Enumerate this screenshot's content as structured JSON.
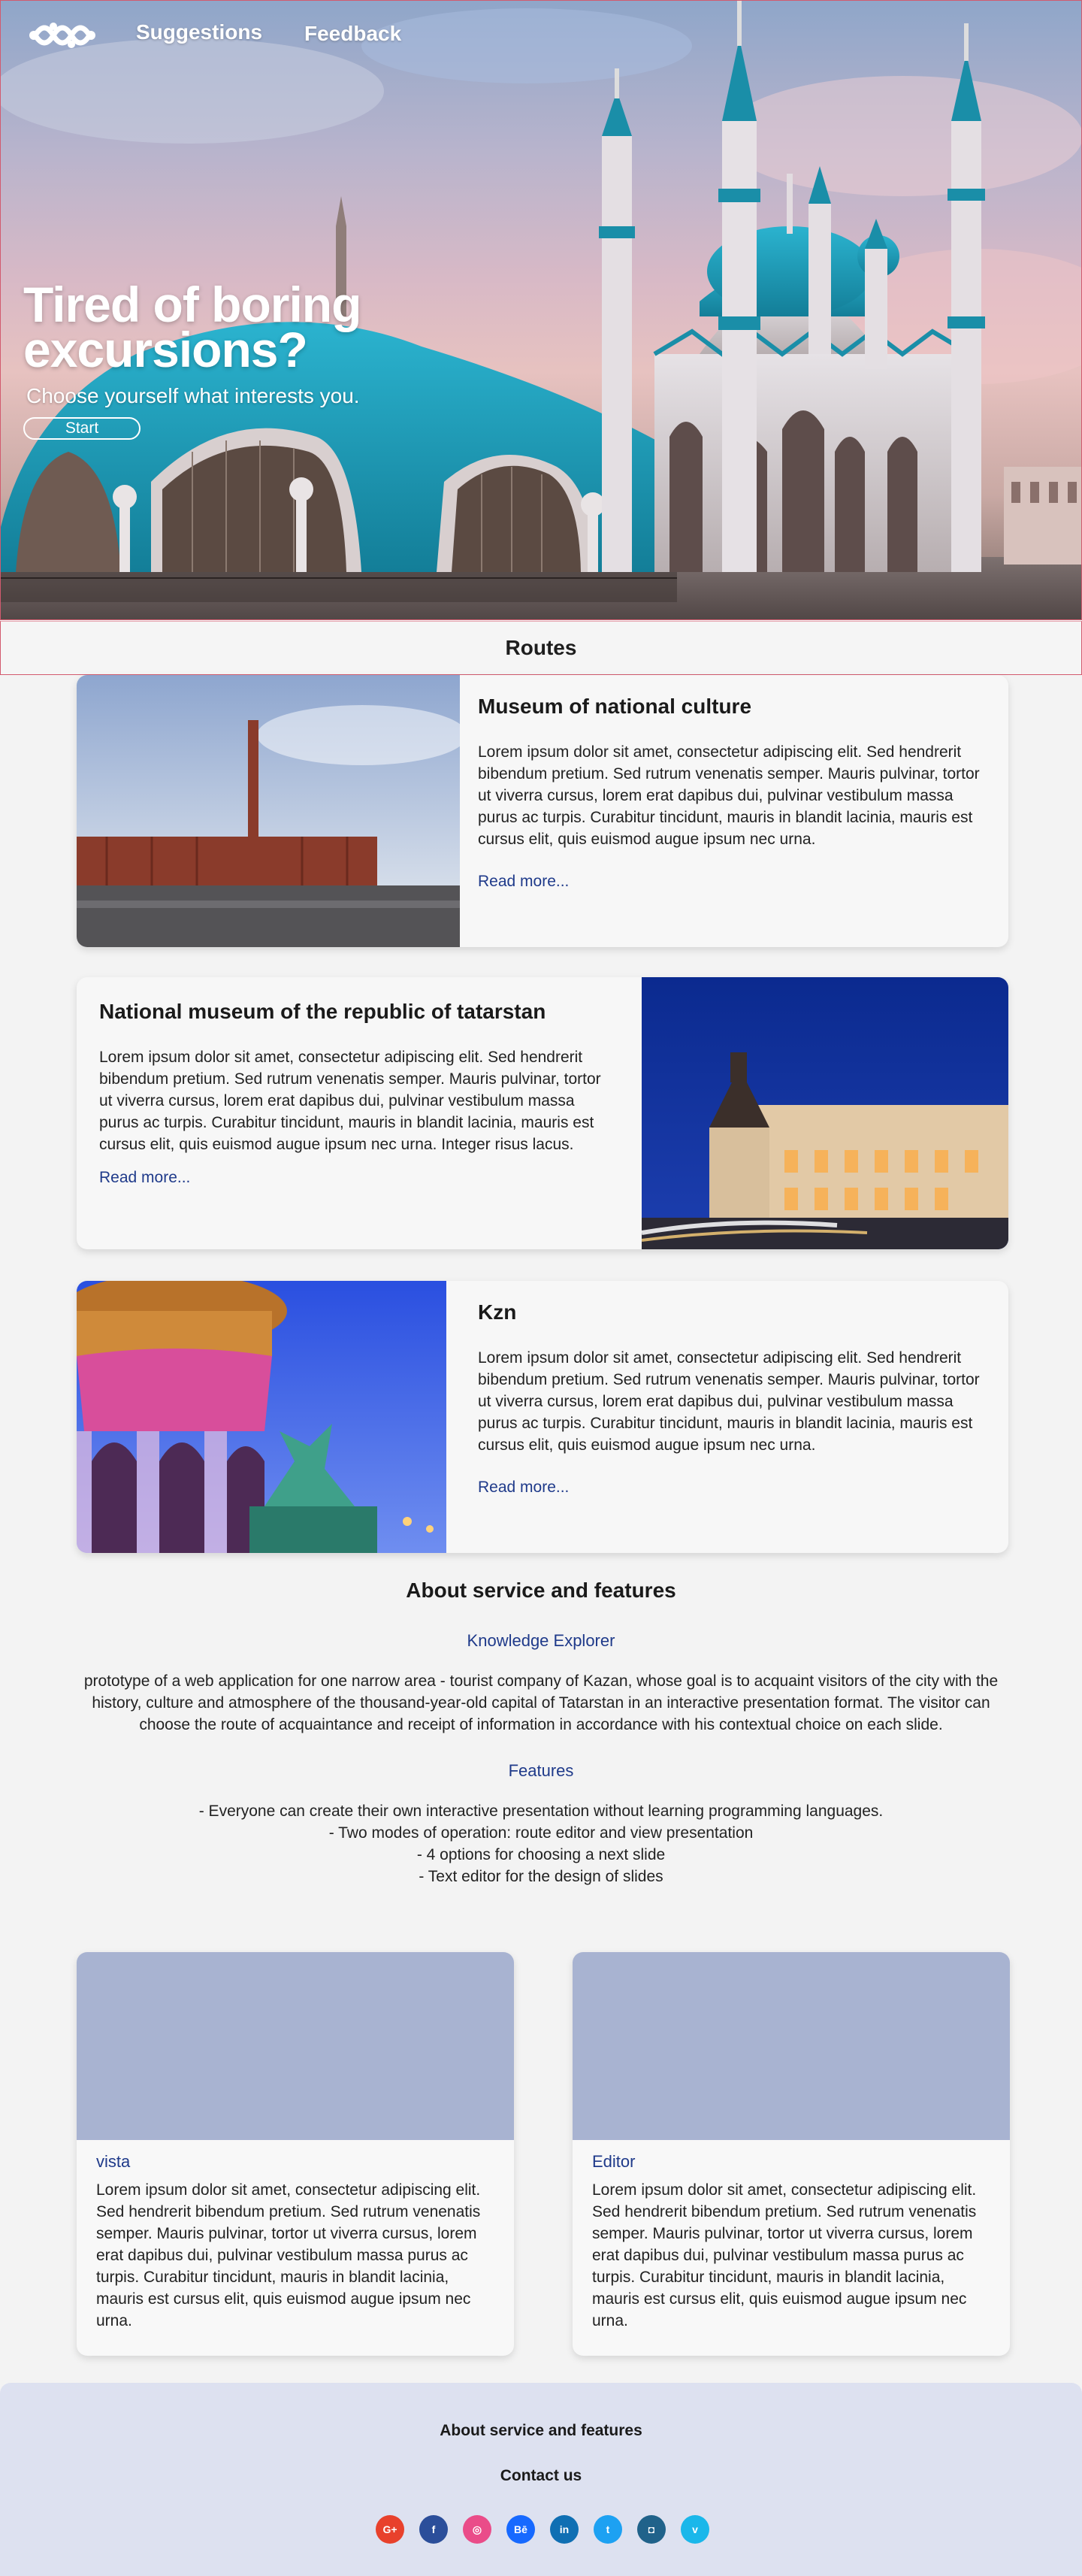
{
  "nav": {
    "links": [
      "Suggestions",
      "Feedback"
    ]
  },
  "hero": {
    "title_line1": "Tired of boring",
    "title_line2": "excursions?",
    "subtitle": "Choose yourself what interests you.",
    "button": "Start"
  },
  "routes": {
    "heading": "Routes",
    "cards": [
      {
        "title": "Museum of national culture",
        "text": "Lorem ipsum dolor sit amet, consectetur adipiscing elit. Sed hendrerit bibendum pretium. Sed rutrum venenatis semper. Mauris pulvinar, tortor ut viverra cursus, lorem erat dapibus dui, pulvinar vestibulum massa purus ac turpis. Curabitur tincidunt, mauris in blandit lacinia, mauris est cursus elit, quis euismod augue ipsum nec urna.",
        "link": "Read more..."
      },
      {
        "title": "National museum of the republic of tatarstan",
        "text": "Lorem ipsum dolor sit amet, consectetur adipiscing elit. Sed hendrerit bibendum pretium. Sed rutrum venenatis semper. Mauris pulvinar, tortor ut viverra cursus, lorem erat dapibus dui, pulvinar vestibulum massa purus ac turpis. Curabitur tincidunt, mauris in blandit lacinia, mauris est cursus elit, quis euismod augue ipsum nec urna. Integer risus lacus.",
        "link": "Read more..."
      },
      {
        "title": "Kzn",
        "text": "Lorem ipsum dolor sit amet, consectetur adipiscing elit. Sed hendrerit bibendum pretium. Sed rutrum venenatis semper. Mauris pulvinar, tortor ut viverra cursus, lorem erat dapibus dui, pulvinar vestibulum massa purus ac turpis. Curabitur tincidunt, mauris in blandit lacinia, mauris est cursus elit, quis euismod augue ipsum nec urna.",
        "link": "Read more..."
      }
    ]
  },
  "about": {
    "heading": "About service and features",
    "explorer_title": "Knowledge Explorer",
    "explorer_text": "prototype of a web application for one narrow area - tourist company of Kazan, whose goal is to acquaint visitors of the city with the history, culture and atmosphere of the thousand-year-old capital of Tatarstan in an interactive presentation format. The visitor can choose the route of acquaintance and receipt of information in accordance with his contextual choice on each slide.",
    "features_title": "Features",
    "features": [
      "- Everyone can create their own interactive presentation without learning programming languages.",
      "- Two modes of operation: route editor and view presentation",
      "- 4 options for choosing a next slide",
      "- Text editor for the design of slides"
    ]
  },
  "feature_cards": [
    {
      "title": "vista",
      "text": "Lorem ipsum dolor sit amet, consectetur adipiscing elit. Sed hendrerit bibendum pretium. Sed rutrum venenatis semper. Mauris pulvinar, tortor ut viverra cursus, lorem erat dapibus dui, pulvinar vestibulum massa purus ac turpis. Curabitur tincidunt, mauris in blandit lacinia, mauris est cursus elit, quis euismod augue ipsum nec urna."
    },
    {
      "title": "Editor",
      "text": "Lorem ipsum dolor sit amet, consectetur adipiscing elit. Sed hendrerit bibendum pretium. Sed rutrum venenatis semper. Mauris pulvinar, tortor ut viverra cursus, lorem erat dapibus dui, pulvinar vestibulum massa purus ac turpis. Curabitur tincidunt, mauris in blandit lacinia, mauris est cursus elit, quis euismod augue ipsum nec urna."
    }
  ],
  "footer": {
    "about_link": "About service and features",
    "contact_link": "Contact us",
    "social": [
      {
        "name": "google-plus-icon",
        "glyph": "G+",
        "color": "#e8412c"
      },
      {
        "name": "facebook-icon",
        "glyph": "f",
        "color": "#2b4e9a"
      },
      {
        "name": "dribbble-icon",
        "glyph": "◎",
        "color": "#ea4c89"
      },
      {
        "name": "behance-icon",
        "glyph": "Bē",
        "color": "#1769ff"
      },
      {
        "name": "linkedin-icon",
        "glyph": "in",
        "color": "#0f6fb3"
      },
      {
        "name": "twitter-icon",
        "glyph": "t",
        "color": "#1da1f2"
      },
      {
        "name": "instagram-icon",
        "glyph": "◘",
        "color": "#20628a"
      },
      {
        "name": "vimeo-icon",
        "glyph": "v",
        "color": "#1ab7ea"
      }
    ]
  }
}
